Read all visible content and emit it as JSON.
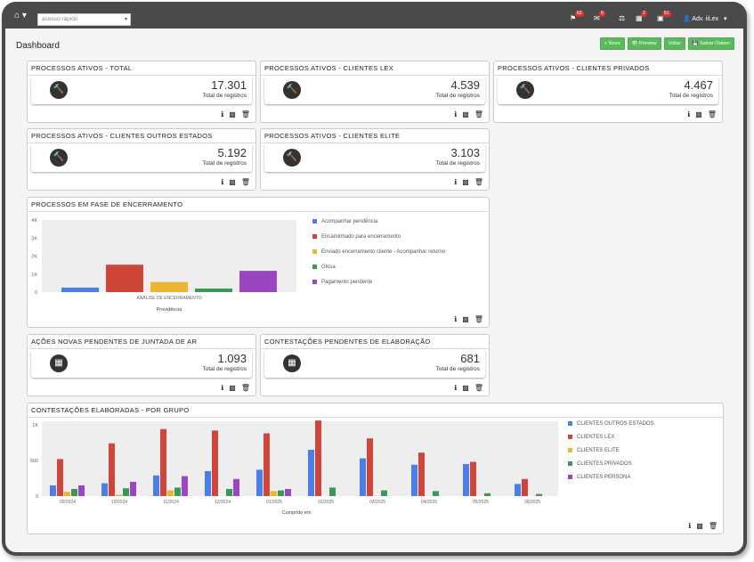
{
  "topbar": {
    "quick_access_placeholder": "acesso rápido",
    "badges": [
      "63",
      "9",
      "2",
      "51"
    ],
    "user_label": "Adv. iiLex"
  },
  "page": {
    "title": "Dashboard"
  },
  "toolbar": {
    "new_label": "+ Novo",
    "preview_label": "Preview",
    "back_label": "Voltar",
    "save_order_label": "Salvar Ordem"
  },
  "kpis": [
    {
      "title": "PROCESSOS ATIVOS - TOTAL",
      "value": "17.301",
      "label": "Total de registros",
      "icon": "gavel-icon"
    },
    {
      "title": "PROCESSOS ATIVOS - CLIENTES LEX",
      "value": "4.539",
      "label": "Total de registros",
      "icon": "gavel-icon"
    },
    {
      "title": "PROCESSOS ATIVOS - CLIENTES PRIVADOS",
      "value": "4.467",
      "label": "Total de registros",
      "icon": "gavel-icon"
    },
    {
      "title": "PROCESSOS ATIVOS - CLIENTES OUTROS ESTADOS",
      "value": "5.192",
      "label": "Total de registros",
      "icon": "gavel-icon"
    },
    {
      "title": "PROCESSOS ATIVOS - CLIENTES ELITE",
      "value": "3.103",
      "label": "Total de registros",
      "icon": "gavel-icon"
    },
    {
      "title": "AÇÕES NOVAS PENDENTES DE JUNTADA DE AR",
      "value": "1.093",
      "label": "Total de registros",
      "icon": "calendar-icon"
    },
    {
      "title": "CONTESTAÇÕES PENDENTES DE ELABORAÇÃO",
      "value": "681",
      "label": "Total de registros",
      "icon": "calendar-icon"
    }
  ],
  "chart_data": [
    {
      "title": "PROCESSOS EM FASE DE ENCERRAMENTO",
      "type": "bar",
      "categories": [
        "ANÁLISE DE ENCERRAMENTO"
      ],
      "xlabel": "Providência",
      "ylim": [
        0,
        4000
      ],
      "yticks": [
        "0",
        "1K",
        "2K",
        "3K",
        "4K"
      ],
      "series": [
        {
          "name": "Acompanhar pendência",
          "values": [
            250
          ],
          "color": "#4a7ee8"
        },
        {
          "name": "Encaminhado para encerramento",
          "values": [
            1520
          ],
          "color": "#d0453a"
        },
        {
          "name": "Enviado encerramento cliente - Acompanhar retorno",
          "values": [
            560
          ],
          "color": "#eab530"
        },
        {
          "name": "Glosa",
          "values": [
            200
          ],
          "color": "#3a9a55"
        },
        {
          "name": "Pagamento pendente",
          "values": [
            1180
          ],
          "color": "#9b45c2"
        }
      ]
    },
    {
      "title": "CONTESTAÇÕES ELABORADAS - POR GRUPO",
      "type": "bar",
      "categories": [
        "09/2024",
        "10/2024",
        "11/2024",
        "12/2024",
        "01/2025",
        "02/2025",
        "03/2025",
        "04/2025",
        "05/2025",
        "06/2025"
      ],
      "xlabel": "Cumprido em",
      "ylim": [
        0,
        1050
      ],
      "yticks": [
        "0",
        "500",
        "1K"
      ],
      "series": [
        {
          "name": "CLIENTES OUTROS ESTADOS",
          "values": [
            150,
            180,
            290,
            350,
            370,
            650,
            530,
            440,
            450,
            170
          ],
          "color": "#4a7ee8"
        },
        {
          "name": "CLIENTES LEX",
          "values": [
            520,
            740,
            940,
            920,
            880,
            1060,
            810,
            610,
            480,
            240
          ],
          "color": "#d0453a"
        },
        {
          "name": "CLIENTES ELITE",
          "values": [
            60,
            20,
            80,
            0,
            70,
            0,
            0,
            0,
            0,
            0
          ],
          "color": "#eab530"
        },
        {
          "name": "CLIENTES PRIVADOS",
          "values": [
            100,
            110,
            120,
            100,
            80,
            120,
            80,
            70,
            40,
            30
          ],
          "color": "#3a9a55"
        },
        {
          "name": "CLIENTES PERSONA",
          "values": [
            150,
            200,
            280,
            240,
            100,
            0,
            0,
            0,
            0,
            0
          ],
          "color": "#9b45c2"
        }
      ]
    }
  ]
}
